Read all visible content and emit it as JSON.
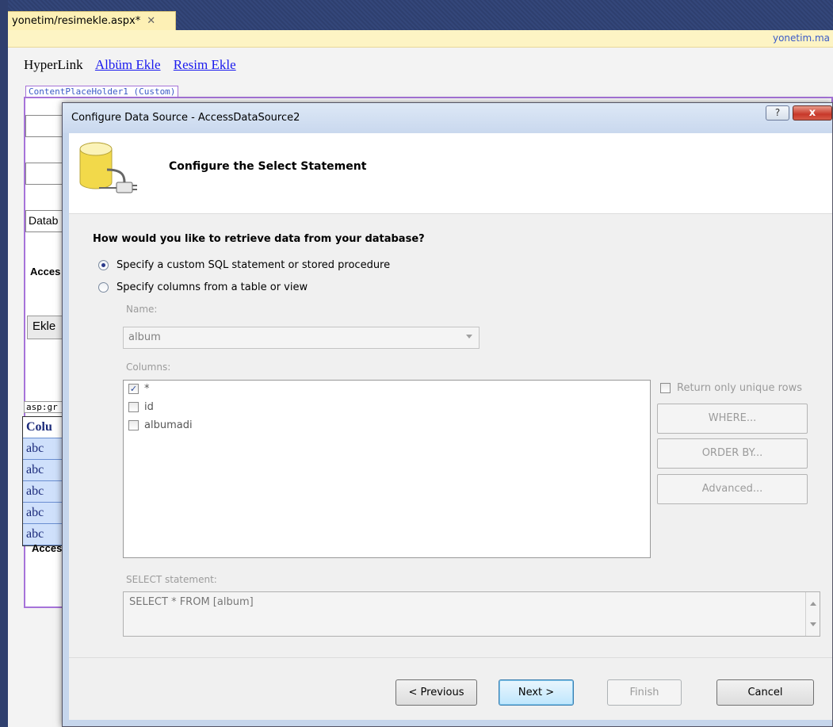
{
  "ide": {
    "doc_tab_label": "yonetim/resimekle.aspx*",
    "doc_tab_close": "✕",
    "master_page_link": "yonetim.ma",
    "hyperlinks": [
      "HyperLink",
      "Albüm Ekle",
      "Resim Ekle"
    ],
    "content_placeholder_label": "ContentPlaceHolder1 (Custom)",
    "background_texts": {
      "data": "Datab",
      "access1": "Acces",
      "ekle": "Ekle",
      "grid_tag": "asp:gr",
      "access2": "Acces"
    },
    "grid": {
      "header": "Colu",
      "rows": [
        "abc",
        "abc",
        "abc",
        "abc",
        "abc"
      ]
    }
  },
  "dialog": {
    "title": "Configure Data Source - AccessDataSource2",
    "help_glyph": "?",
    "close_glyph": "x",
    "header_title": "Configure the Select Statement",
    "question": "How would you like to retrieve data from your database?",
    "options": [
      {
        "label": "Specify a custom SQL statement or stored procedure",
        "selected": true
      },
      {
        "label": "Specify columns from a table or view",
        "selected": false
      }
    ],
    "name_label": "Name:",
    "name_value": "album",
    "columns_label": "Columns:",
    "columns": [
      {
        "label": "*",
        "checked": true
      },
      {
        "label": "id",
        "checked": false
      },
      {
        "label": "albumadi",
        "checked": false
      }
    ],
    "unique_rows_label": "Return only unique rows",
    "where_label": "WHERE...",
    "orderby_label": "ORDER BY...",
    "advanced_label": "Advanced...",
    "select_statement_label": "SELECT statement:",
    "select_statement_value": "SELECT * FROM [album]",
    "buttons": {
      "previous": "< Previous",
      "next": "Next >",
      "finish": "Finish",
      "cancel": "Cancel"
    }
  }
}
